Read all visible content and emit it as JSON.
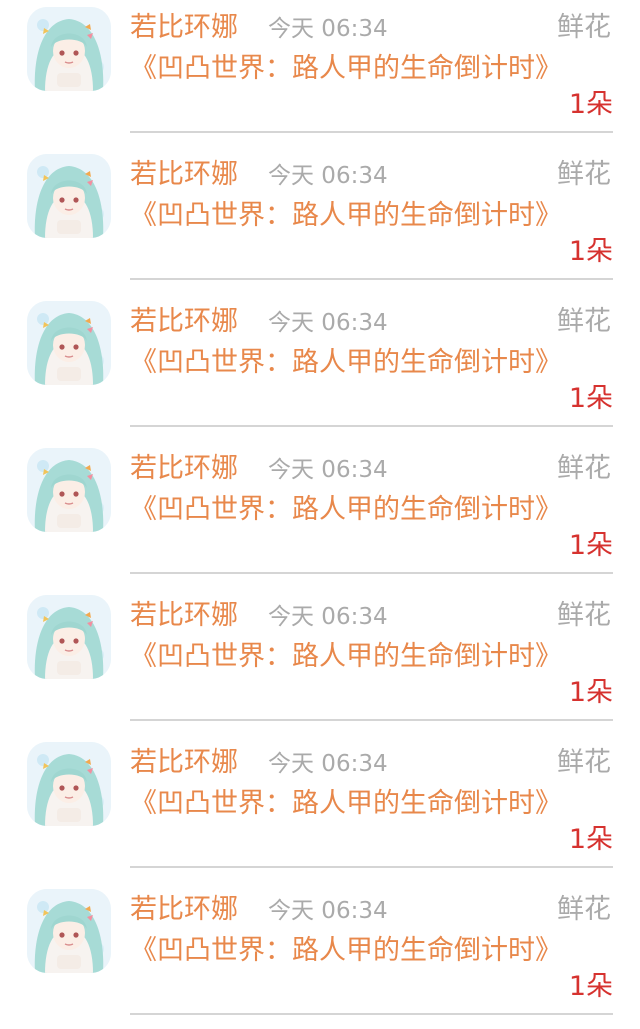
{
  "items": [
    {
      "username": "若比环娜",
      "time": "今天 06:34",
      "gift_type": "鲜花",
      "book_title": "《凹凸世界：路人甲的生命倒计时》",
      "count": "1朵"
    },
    {
      "username": "若比环娜",
      "time": "今天 06:34",
      "gift_type": "鲜花",
      "book_title": "《凹凸世界：路人甲的生命倒计时》",
      "count": "1朵"
    },
    {
      "username": "若比环娜",
      "time": "今天 06:34",
      "gift_type": "鲜花",
      "book_title": "《凹凸世界：路人甲的生命倒计时》",
      "count": "1朵"
    },
    {
      "username": "若比环娜",
      "time": "今天 06:34",
      "gift_type": "鲜花",
      "book_title": "《凹凸世界：路人甲的生命倒计时》",
      "count": "1朵"
    },
    {
      "username": "若比环娜",
      "time": "今天 06:34",
      "gift_type": "鲜花",
      "book_title": "《凹凸世界：路人甲的生命倒计时》",
      "count": "1朵"
    },
    {
      "username": "若比环娜",
      "time": "今天 06:34",
      "gift_type": "鲜花",
      "book_title": "《凹凸世界：路人甲的生命倒计时》",
      "count": "1朵"
    },
    {
      "username": "若比环娜",
      "time": "今天 06:34",
      "gift_type": "鲜花",
      "book_title": "《凹凸世界：路人甲的生命倒计时》",
      "count": "1朵"
    }
  ],
  "colors": {
    "accent": "#e8884b",
    "muted": "#aaaaaa",
    "count": "#d6322f",
    "divider": "#d5d5d5"
  },
  "icons": {
    "avatar": "user-avatar-illustration"
  }
}
